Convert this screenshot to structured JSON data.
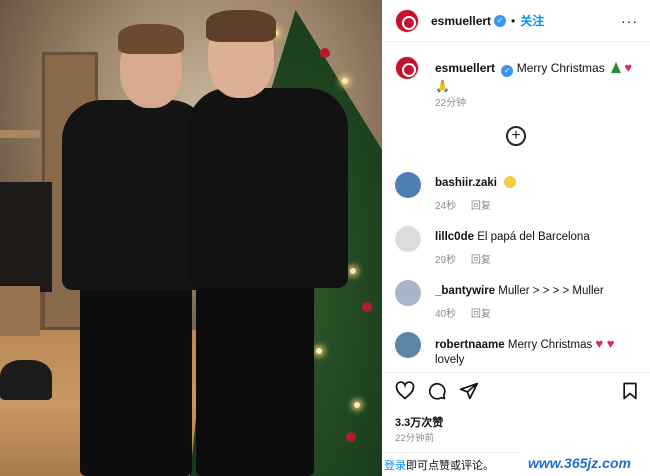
{
  "header": {
    "username": "esmuellert",
    "verified_glyph": "✓",
    "separator": "•",
    "follow_label": "关注",
    "more_label": "···"
  },
  "caption": {
    "username": "esmuellert",
    "text": "Merry Christmas",
    "emoji_heart": "♥",
    "emoji_pray": "🙏",
    "time": "22分钟"
  },
  "add_comment_label": "+",
  "comments": [
    {
      "username": "bashiir.zaki",
      "text": "",
      "time": "24秒",
      "reply": "回复",
      "avatar_color": "#4c7fb0"
    },
    {
      "username": "lillc0de",
      "text": "El papá del Barcelona",
      "time": "29秒",
      "reply": "回复",
      "avatar_color": "#dcdcdc"
    },
    {
      "username": "_bantywire",
      "text": "Muller > > > > Muller",
      "time": "40秒",
      "reply": "回复",
      "avatar_color": "#a9b3c9"
    },
    {
      "username": "robertnaame",
      "text": "Merry Christmas",
      "text2": "lovely",
      "hearts": "♥ ♥",
      "avatar_color": "#5b86a8"
    }
  ],
  "likes": "3.3万次赞",
  "post_time": "22分钟前",
  "footer": {
    "login": "登录",
    "rest": "即可点赞或评论。"
  },
  "watermark": "www.365jz.com",
  "colors": {
    "link": "#0095f6",
    "muted": "#8e8e8e",
    "verified": "#3897f0",
    "brand_red": "#c8102e"
  },
  "icons": [
    "heart-icon",
    "comment-icon",
    "share-icon",
    "bookmark-icon",
    "more-options-icon",
    "add-comment-icon",
    "verified-badge-icon"
  ]
}
